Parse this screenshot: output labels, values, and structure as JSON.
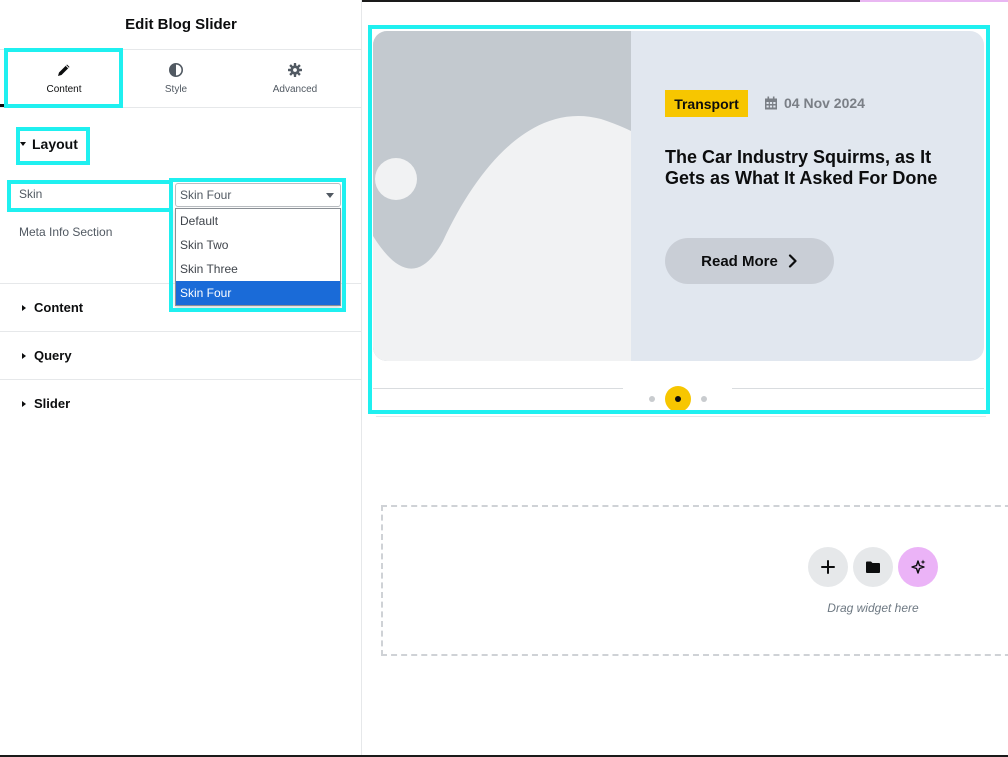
{
  "panel": {
    "title": "Edit Blog Slider",
    "tabs": [
      {
        "label": "Content",
        "icon": "pencil-icon",
        "active": true
      },
      {
        "label": "Style",
        "icon": "half-circle-icon",
        "active": false
      },
      {
        "label": "Advanced",
        "icon": "gear-icon",
        "active": false
      }
    ],
    "layout_section": "Layout",
    "skin_label": "Skin",
    "skin_value": "Skin Four",
    "skin_options": [
      "Default",
      "Skin Two",
      "Skin Three",
      "Skin Four"
    ],
    "meta_info_label": "Meta Info Section",
    "sections": [
      "Content",
      "Query",
      "Slider"
    ]
  },
  "slide": {
    "category": "Transport",
    "date": "04 Nov 2024",
    "title": "The Car Industry Squirms, as It Gets as What It Asked For Done",
    "button_label": "Read More",
    "active_dot": 2,
    "dot_count": 3
  },
  "canvas": {
    "drag_text": "Drag widget here",
    "buttons": [
      "plus-icon",
      "folder-icon",
      "sparkles-icon"
    ]
  },
  "colors": {
    "highlight": "#1ff0f0",
    "badge": "#f7c600",
    "dot_active": "#f7c600",
    "selected_option": "#1a6bd8",
    "ai_button": "#ebb3f7"
  }
}
